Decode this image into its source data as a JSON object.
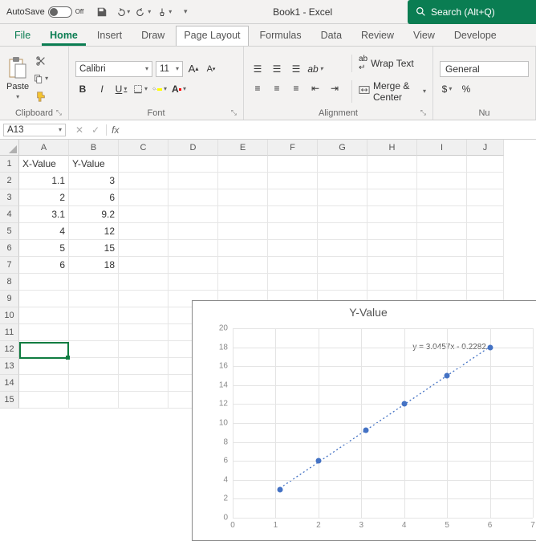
{
  "titlebar": {
    "autosave_label": "AutoSave",
    "autosave_state": "Off",
    "doc_title": "Book1 - Excel",
    "search_placeholder": "Search (Alt+Q)"
  },
  "tabs": {
    "file": "File",
    "home": "Home",
    "insert": "Insert",
    "draw": "Draw",
    "page_layout": "Page Layout",
    "formulas": "Formulas",
    "data": "Data",
    "review": "Review",
    "view": "View",
    "developer": "Develope"
  },
  "ribbon": {
    "clipboard": {
      "label": "Clipboard",
      "paste": "Paste"
    },
    "font": {
      "label": "Font",
      "name": "Calibri",
      "size": "11",
      "bold": "B",
      "italic": "I",
      "underline": "U"
    },
    "alignment": {
      "label": "Alignment",
      "wrap": "Wrap Text",
      "merge": "Merge & Center"
    },
    "number": {
      "label": "Nu",
      "format": "General",
      "currency": "$"
    }
  },
  "namebox": "A13",
  "fx": "fx",
  "columns": [
    "A",
    "B",
    "C",
    "D",
    "E",
    "F",
    "G",
    "H",
    "I",
    "J"
  ],
  "rownums": [
    "1",
    "2",
    "3",
    "4",
    "5",
    "6",
    "7",
    "8",
    "9",
    "10",
    "11",
    "12",
    "13",
    "14",
    "15"
  ],
  "data_headers": {
    "x": "X-Value",
    "y": "Y-Value"
  },
  "data_rows": [
    {
      "x": "1.1",
      "y": "3"
    },
    {
      "x": "2",
      "y": "6"
    },
    {
      "x": "3.1",
      "y": "9.2"
    },
    {
      "x": "4",
      "y": "12"
    },
    {
      "x": "5",
      "y": "15"
    },
    {
      "x": "6",
      "y": "18"
    }
  ],
  "chart_data": {
    "type": "scatter",
    "title": "Y-Value",
    "xlabel": "",
    "ylabel": "",
    "xlim": [
      0,
      7
    ],
    "ylim": [
      0,
      20
    ],
    "xticks": [
      0,
      1,
      2,
      3,
      4,
      5,
      6,
      7
    ],
    "yticks": [
      0,
      2,
      4,
      6,
      8,
      10,
      12,
      14,
      16,
      18,
      20
    ],
    "x": [
      1.1,
      2,
      3.1,
      4,
      5,
      6
    ],
    "y": [
      3,
      6,
      9.2,
      12,
      15,
      18
    ],
    "trendline": {
      "slope": 3.0457,
      "intercept": -0.2282,
      "equation": "y = 3.0457x - 0.2282"
    }
  }
}
